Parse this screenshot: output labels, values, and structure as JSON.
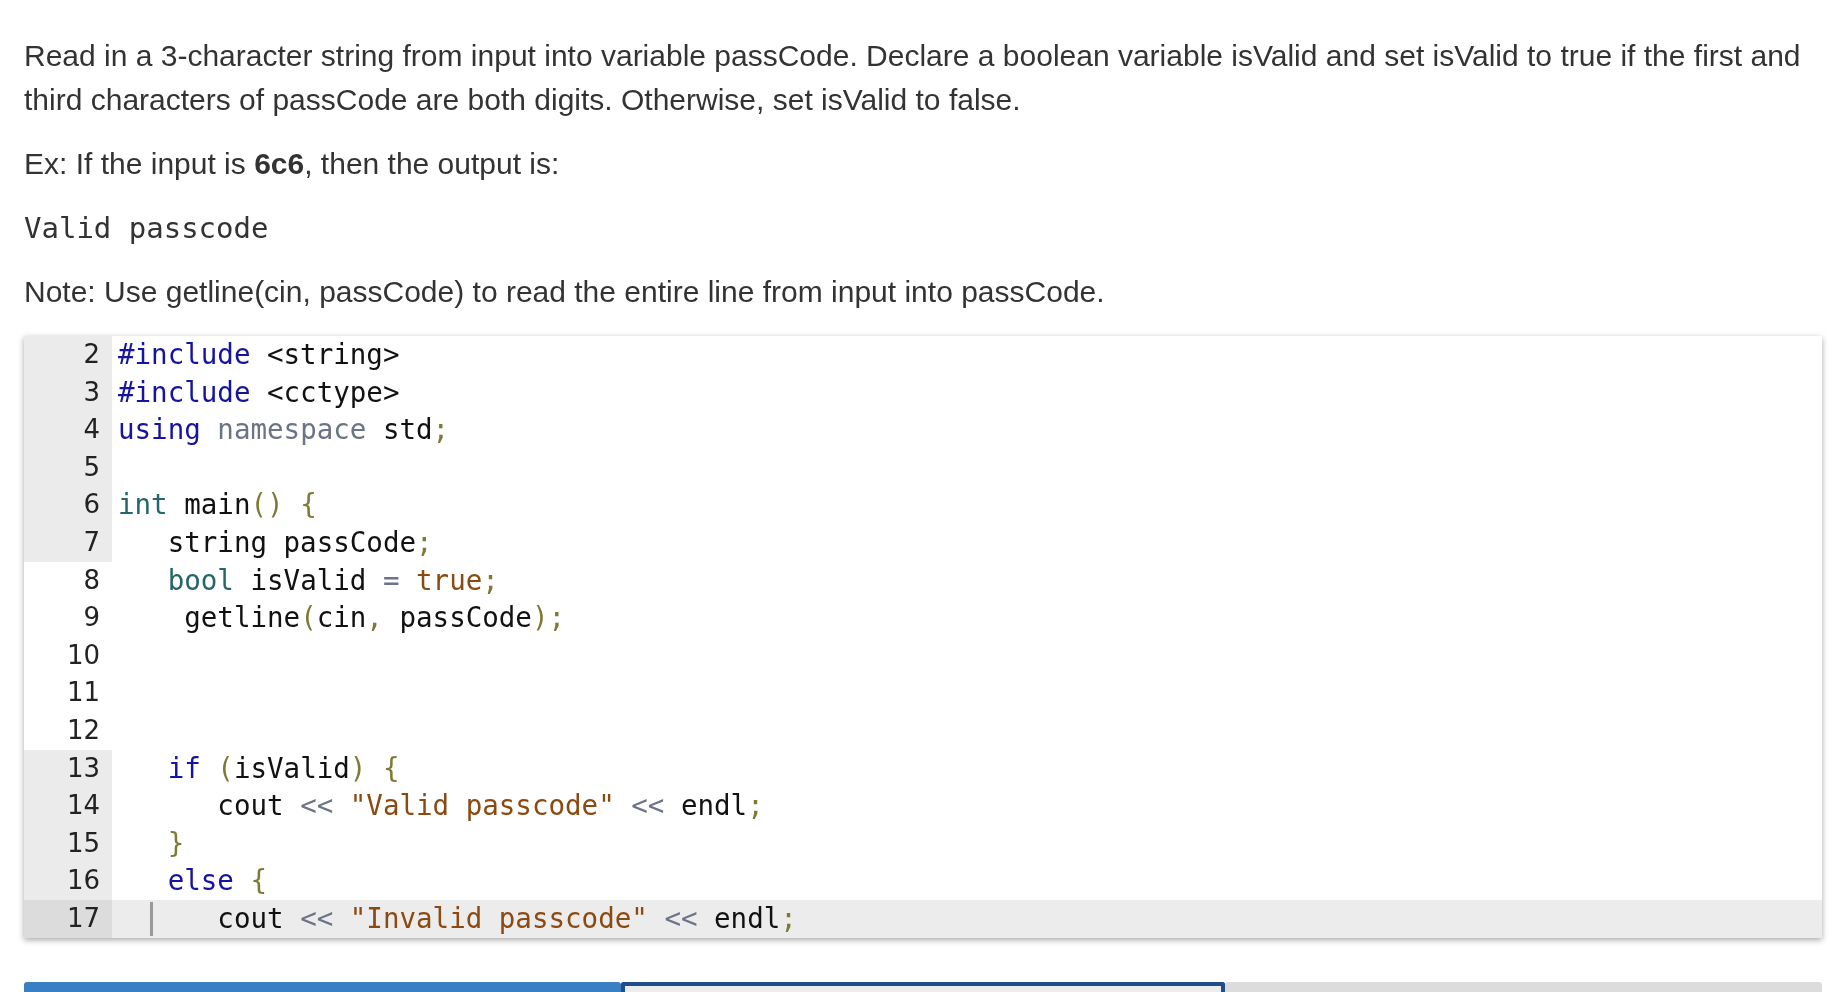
{
  "instructions": "Read in a 3-character string from input into variable passCode. Declare a boolean variable isValid and set isValid to true if the first and third characters of passCode are both digits. Otherwise, set isValid to false.",
  "example": "Ex: If the input is **6c6**, then the output is:",
  "example_output": "Valid passcode",
  "note": "Note: Use getline(cin, passCode) to read the entire line from input into passCode.",
  "editor": {
    "lines": [
      {
        "number": "2",
        "shaded": true,
        "active": false,
        "tokens": [
          {
            "kind": "keyword",
            "text": "#include"
          },
          {
            "kind": "plain",
            "text": " <string>"
          }
        ]
      },
      {
        "number": "3",
        "shaded": true,
        "active": false,
        "tokens": [
          {
            "kind": "keyword",
            "text": "#include"
          },
          {
            "kind": "plain",
            "text": " <cctype>"
          }
        ]
      },
      {
        "number": "4",
        "shaded": true,
        "active": false,
        "tokens": [
          {
            "kind": "keyword",
            "text": "using"
          },
          {
            "kind": "muted",
            "text": " namespace"
          },
          {
            "kind": "plain",
            "text": " std"
          },
          {
            "kind": "punct",
            "text": ";"
          }
        ]
      },
      {
        "number": "5",
        "shaded": true,
        "active": false
      },
      {
        "number": "6",
        "shaded": true,
        "active": false,
        "tokens": [
          {
            "kind": "type",
            "text": "int"
          },
          {
            "kind": "plain",
            "text": " main"
          },
          {
            "kind": "punct",
            "text": "() {"
          }
        ]
      },
      {
        "number": "7",
        "shaded": true,
        "active": false,
        "tokens": [
          {
            "kind": "plain",
            "text": "   string passCode"
          },
          {
            "kind": "punct",
            "text": ";"
          }
        ]
      },
      {
        "number": "8",
        "shaded": false,
        "active": false,
        "tokens": [
          {
            "kind": "type",
            "text": "   bool"
          },
          {
            "kind": "plain",
            "text": " isValid"
          },
          {
            "kind": "muted",
            "text": " ="
          },
          {
            "kind": "string",
            "text": " true"
          },
          {
            "kind": "punct",
            "text": ";"
          }
        ]
      },
      {
        "number": "9",
        "shaded": false,
        "active": false,
        "tokens": [
          {
            "kind": "plain",
            "text": "    getline"
          },
          {
            "kind": "punct",
            "text": "("
          },
          {
            "kind": "plain",
            "text": "cin"
          },
          {
            "kind": "punct",
            "text": ","
          },
          {
            "kind": "plain",
            "text": " passCode"
          },
          {
            "kind": "punct",
            "text": ");"
          }
        ]
      },
      {
        "number": "10",
        "shaded": false,
        "active": false
      },
      {
        "number": "11",
        "shaded": false,
        "active": false
      },
      {
        "number": "12",
        "shaded": false,
        "active": false
      },
      {
        "number": "13",
        "shaded": true,
        "active": false,
        "tokens": [
          {
            "kind": "keyword",
            "text": "   if"
          },
          {
            "kind": "punct",
            "text": " ("
          },
          {
            "kind": "plain",
            "text": "isValid"
          },
          {
            "kind": "punct",
            "text": ") {"
          }
        ]
      },
      {
        "number": "14",
        "shaded": true,
        "active": false,
        "tokens": [
          {
            "kind": "plain",
            "text": "      cout"
          },
          {
            "kind": "muted",
            "text": " <<"
          },
          {
            "kind": "string",
            "text": " \"Valid passcode\""
          },
          {
            "kind": "muted",
            "text": " <<"
          },
          {
            "kind": "plain",
            "text": " endl"
          },
          {
            "kind": "punct",
            "text": ";"
          }
        ]
      },
      {
        "number": "15",
        "shaded": true,
        "active": false,
        "tokens": [
          {
            "kind": "punct",
            "text": "   }"
          }
        ]
      },
      {
        "number": "16",
        "shaded": true,
        "active": false,
        "tokens": [
          {
            "kind": "keyword",
            "text": "   else"
          },
          {
            "kind": "punct",
            "text": " {"
          }
        ]
      },
      {
        "number": "17",
        "shaded": true,
        "active": true,
        "tokens": [
          {
            "kind": "plain",
            "text": "      cout"
          },
          {
            "kind": "muted",
            "text": " <<"
          },
          {
            "kind": "string",
            "text": " \"Invalid passcode\""
          },
          {
            "kind": "muted",
            "text": " <<"
          },
          {
            "kind": "plain",
            "text": " endl"
          },
          {
            "kind": "punct",
            "text": ";"
          }
        ]
      }
    ]
  },
  "levels": [
    {
      "completed": true,
      "selected": false
    },
    {
      "completed": false,
      "selected": true
    },
    {
      "completed": false,
      "selected": false
    }
  ]
}
